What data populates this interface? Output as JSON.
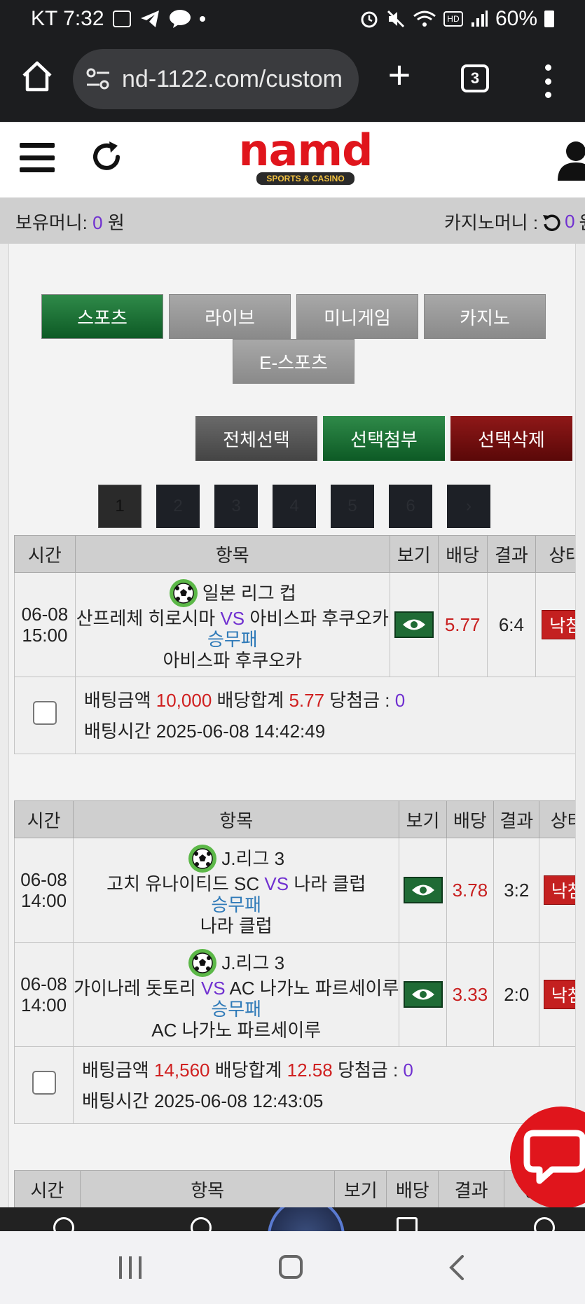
{
  "status_bar": {
    "carrier_time": "KT 7:32",
    "battery": "60%"
  },
  "browser": {
    "url": "nd-1122.com/custom",
    "tab_count": "3"
  },
  "header": {
    "logo_text": "namd",
    "logo_subtext": "SPORTS & CASINO"
  },
  "money": {
    "holding_label": "보유머니: ",
    "holding_value": "0",
    "holding_unit": " 원",
    "casino_label": "카지노머니 : ",
    "casino_value": "0",
    "casino_unit": "원"
  },
  "category_tabs": [
    {
      "label": "스포츠",
      "active": true
    },
    {
      "label": "라이브",
      "active": false
    },
    {
      "label": "미니게임",
      "active": false
    },
    {
      "label": "카지노",
      "active": false
    },
    {
      "label": "E-스포츠",
      "active": false
    }
  ],
  "actions": {
    "select_all": "전체선택",
    "attach_selected": "선택첨부",
    "delete_selected": "선택삭제"
  },
  "pagination": {
    "pages": [
      "1",
      "2",
      "3",
      "4",
      "5",
      "6"
    ],
    "current": "1",
    "next": "›"
  },
  "table_headers": {
    "time": "시간",
    "item": "항목",
    "view": "보기",
    "odds": "배당",
    "result": "결과",
    "status": "상태"
  },
  "bet_slips": [
    {
      "games": [
        {
          "date": "06-08",
          "time": "15:00",
          "league": "일본 리그 컵",
          "home": "산프레체 히로시마",
          "vs": "VS",
          "away": "아비스파 후쿠오카",
          "bet_type": "승무패",
          "pick": "아비스파 후쿠오카",
          "odds": "5.77",
          "result": "6:4",
          "status": "낙첨"
        }
      ],
      "summary": {
        "bet_amount_label": "배팅금액",
        "bet_amount": "10,000",
        "total_odds_label": "배당합계",
        "total_odds": "5.77",
        "win_amount_label": "당첨금 :",
        "win_amount": "0",
        "bet_time_label": "배팅시간",
        "bet_time": "2025-06-08 14:42:49"
      }
    },
    {
      "games": [
        {
          "date": "06-08",
          "time": "14:00",
          "league": "J.리그 3",
          "home": "고치 유나이티드 SC",
          "vs": "VS",
          "away": "나라 클럽",
          "bet_type": "승무패",
          "pick": "나라 클럽",
          "odds": "3.78",
          "result": "3:2",
          "status": "낙첨"
        },
        {
          "date": "06-08",
          "time": "14:00",
          "league": "J.리그 3",
          "home": "가이나레 돗토리",
          "vs": "VS",
          "away": "AC 나가노 파르세이루",
          "bet_type": "승무패",
          "pick": "AC 나가노 파르세이루",
          "odds": "3.33",
          "result": "2:0",
          "status": "낙첨"
        }
      ],
      "summary": {
        "bet_amount_label": "배팅금액",
        "bet_amount": "14,560",
        "total_odds_label": "배당합계",
        "total_odds": "12.58",
        "win_amount_label": "당첨금 :",
        "win_amount": "0",
        "bet_time_label": "배팅시간",
        "bet_time": "2025-06-08 12:43:05"
      }
    }
  ],
  "colors": {
    "active_tab": "#1a6b34",
    "tab_gray": "#999999",
    "delete_btn": "#7a1010",
    "status_lost": "#c42020",
    "odds_red": "#c82020",
    "vs_purple": "#7030d0",
    "bet_type_blue": "#2f7ab8",
    "chat_fab": "#e0151c"
  }
}
